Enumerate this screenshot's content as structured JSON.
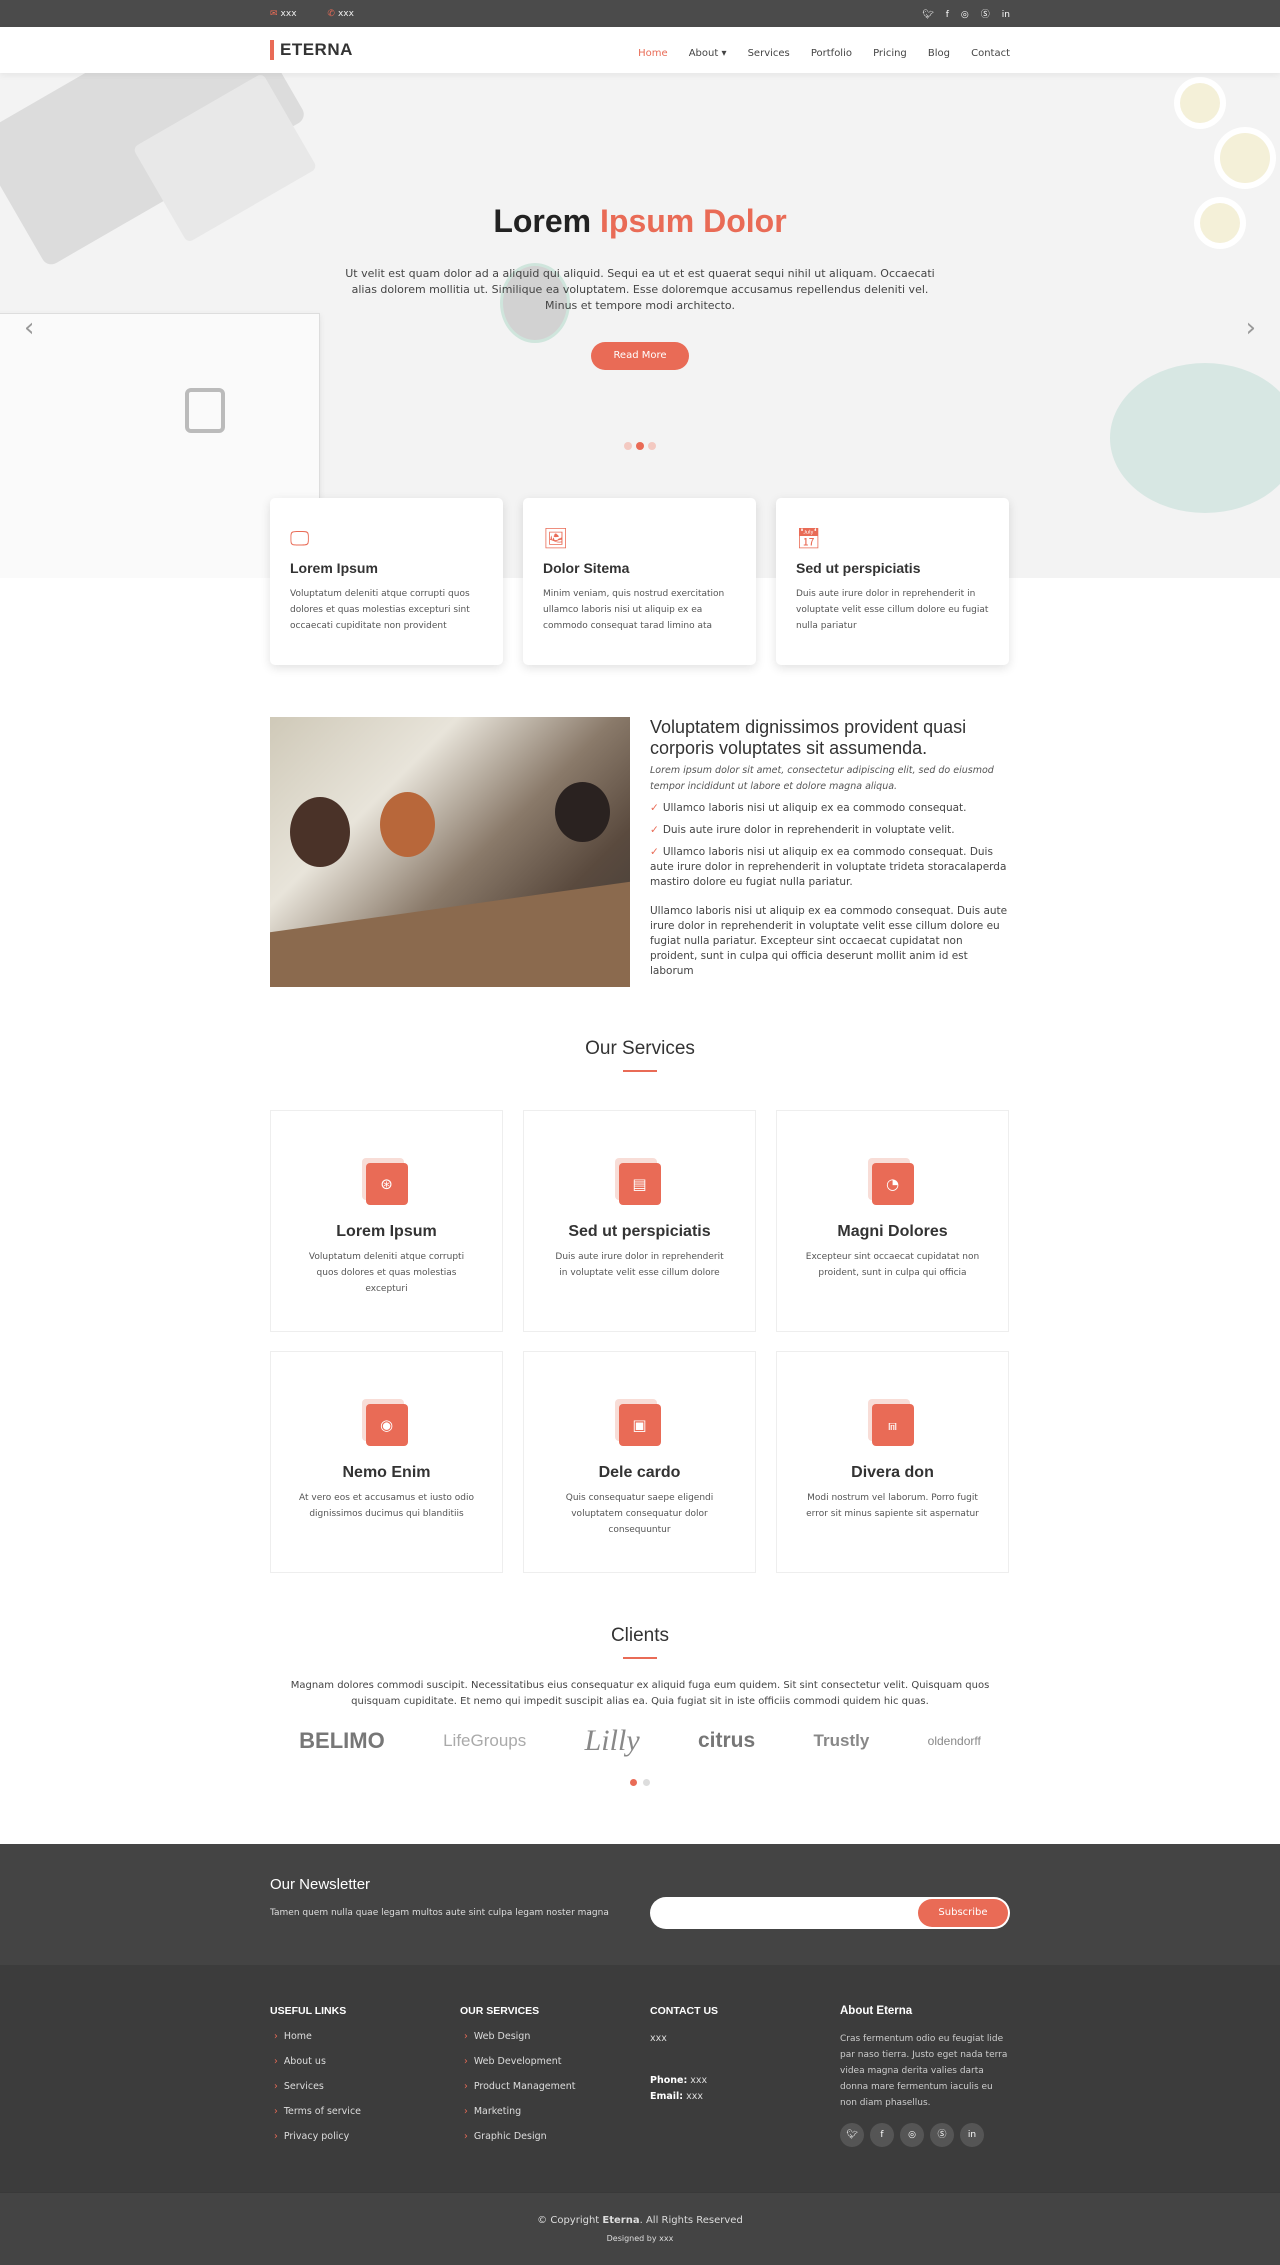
{
  "colors": {
    "accent": "#e96b56",
    "topbar": "#4b4b4b",
    "footer": "#3c3c3c"
  },
  "topbar": {
    "email": "xxx",
    "phone": "xxx",
    "email_icon": "envelope-icon",
    "phone_icon": "phone-icon",
    "social_icons": [
      "twitter-icon",
      "facebook-icon",
      "instagram-icon",
      "skype-icon",
      "linkedin-icon"
    ]
  },
  "header": {
    "logo": "ETERNA",
    "nav": [
      {
        "label": "Home",
        "active": true
      },
      {
        "label": "About ▾"
      },
      {
        "label": "Services"
      },
      {
        "label": "Portfolio"
      },
      {
        "label": "Pricing"
      },
      {
        "label": "Blog"
      },
      {
        "label": "Contact"
      }
    ]
  },
  "hero": {
    "title_dark": "Lorem",
    "title_accent": "Ipsum Dolor",
    "text": "Ut velit est quam dolor ad a aliquid qui aliquid. Sequi ea ut et est quaerat sequi nihil ut aliquam. Occaecati alias dolorem mollitia ut. Similique ea voluptatem. Esse doloremque accusamus repellendus deleniti vel. Minus et tempore modi architecto.",
    "button": "Read More",
    "active_slide": 2,
    "slide_count": 3,
    "prev": "‹",
    "next": "›"
  },
  "icon_boxes": [
    {
      "icon": "monitor-icon",
      "title": "Lorem Ipsum",
      "text": "Voluptatum deleniti atque corrupti quos dolores et quas molestias excepturi sint occaecati cupiditate non provident"
    },
    {
      "icon": "image-icon",
      "title": "Dolor Sitema",
      "text": "Minim veniam, quis nostrud exercitation ullamco laboris nisi ut aliquip ex ea commodo consequat tarad limino ata"
    },
    {
      "icon": "calendar-icon",
      "title": "Sed ut perspiciatis",
      "text": "Duis aute irure dolor in reprehenderit in voluptate velit esse cillum dolore eu fugiat nulla pariatur"
    }
  ],
  "about": {
    "title": "Voluptatem dignissimos provident quasi corporis voluptates sit assumenda.",
    "italic": "Lorem ipsum dolor sit amet, consectetur adipiscing elit, sed do eiusmod tempor incididunt ut labore et dolore magna aliqua.",
    "items": [
      "Ullamco laboris nisi ut aliquip ex ea commodo consequat.",
      "Duis aute irure dolor in reprehenderit in voluptate velit.",
      "Ullamco laboris nisi ut aliquip ex ea commodo consequat. Duis aute irure dolor in reprehenderit in voluptate trideta storacalaperda mastiro dolore eu fugiat nulla pariatur."
    ],
    "paragraph": "Ullamco laboris nisi ut aliquip ex ea commodo consequat. Duis aute irure dolor in reprehenderit in voluptate velit esse cillum dolore eu fugiat nulla pariatur. Excepteur sint occaecat cupidatat non proident, sunt in culpa qui officia deserunt mollit anim id est laborum"
  },
  "services": {
    "title": "Our Services",
    "items": [
      {
        "icon": "dribbble-icon",
        "glyph": "⊛",
        "title": "Lorem Ipsum",
        "text": "Voluptatum deleniti atque corrupti quos dolores et quas molestias excepturi"
      },
      {
        "icon": "file-icon",
        "glyph": "▤",
        "title": "Sed ut perspiciatis",
        "text": "Duis aute irure dolor in reprehenderit in voluptate velit esse cillum dolore"
      },
      {
        "icon": "tachometer-icon",
        "glyph": "◔",
        "title": "Magni Dolores",
        "text": "Excepteur sint occaecat cupidatat non proident, sunt in culpa qui officia"
      },
      {
        "icon": "globe-icon",
        "glyph": "◉",
        "title": "Nemo Enim",
        "text": "At vero eos et accusamus et iusto odio dignissimos ducimus qui blanditiis"
      },
      {
        "icon": "presentation-icon",
        "glyph": "▣",
        "title": "Dele cardo",
        "text": "Quis consequatur saepe eligendi voluptatem consequatur dolor consequuntur"
      },
      {
        "icon": "arch-icon",
        "glyph": "⩎",
        "title": "Divera don",
        "text": "Modi nostrum vel laborum. Porro fugit error sit minus sapiente sit aspernatur"
      }
    ]
  },
  "clients": {
    "title": "Clients",
    "text": "Magnam dolores commodi suscipit. Necessitatibus eius consequatur ex aliquid fuga eum quidem. Sit sint consectetur velit. Quisquam quos quisquam cupiditate. Et nemo qui impedit suscipit alias ea. Quia fugiat sit in iste officiis commodi quidem hic quas.",
    "logos": [
      "BELIMO",
      "LifeGroups",
      "Lilly",
      "citrus",
      "Trustly",
      "oldendorff"
    ],
    "active_slide": 1,
    "slide_count": 2
  },
  "newsletter": {
    "title": "Our Newsletter",
    "text": "Tamen quem nulla quae legam multos aute sint culpa legam noster magna",
    "input_value": "",
    "button": "Subscribe"
  },
  "footer": {
    "useful_links": {
      "title": "USEFUL LINKS",
      "items": [
        "Home",
        "About us",
        "Services",
        "Terms of service",
        "Privacy policy"
      ]
    },
    "our_services": {
      "title": "OUR SERVICES",
      "items": [
        "Web Design",
        "Web Development",
        "Product Management",
        "Marketing",
        "Graphic Design"
      ]
    },
    "contact": {
      "title": "CONTACT US",
      "address": "xxx",
      "phone_label": "Phone:",
      "phone": "xxx",
      "email_label": "Email:",
      "email": "xxx"
    },
    "about": {
      "title": "About Eterna",
      "text": "Cras fermentum odio eu feugiat lide par naso tierra. Justo eget nada terra videa magna derita valies darta donna mare fermentum iaculis eu non diam phasellus.",
      "socials": [
        "twitter-icon",
        "facebook-icon",
        "instagram-icon",
        "skype-icon",
        "linkedin-icon"
      ]
    }
  },
  "copyright": {
    "prefix": "© Copyright",
    "brand": "Eterna",
    "suffix": ". All Rights Reserved",
    "designed": "Designed by xxx"
  }
}
